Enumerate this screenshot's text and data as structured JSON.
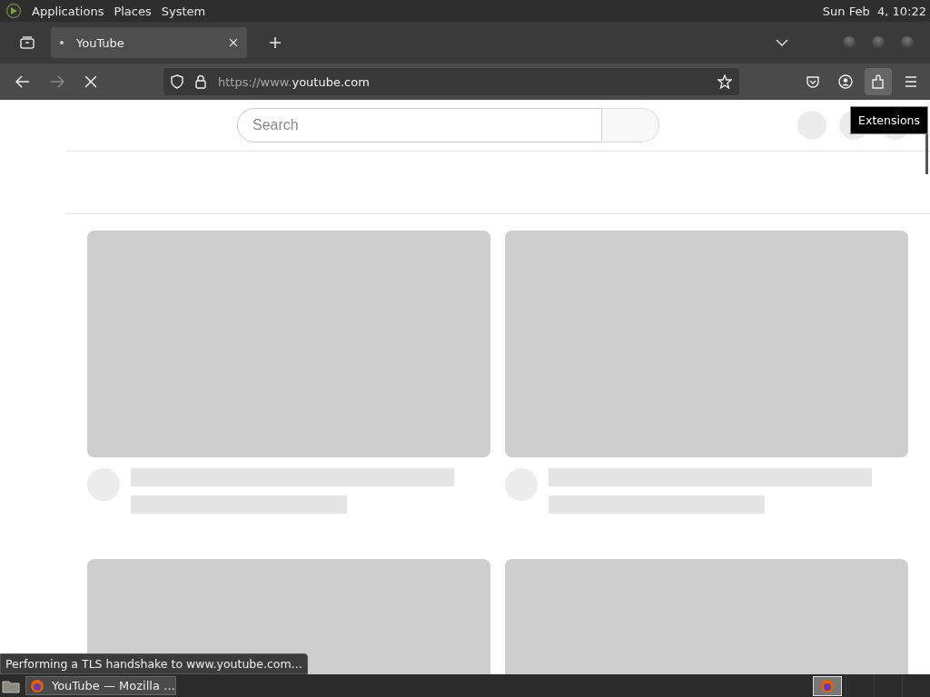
{
  "top_panel": {
    "menus": [
      {
        "label": "Applications"
      },
      {
        "label": "Places"
      },
      {
        "label": "System"
      }
    ],
    "clock": "Sun Feb  4, 10:22"
  },
  "tabs": [
    {
      "title": "YouTube",
      "selected": true
    }
  ],
  "navigation": {
    "loading": true,
    "forward_disabled": true
  },
  "address_bar": {
    "url_prefix": "https://www.",
    "url_host": "youtube.com"
  },
  "toolbar_buttons": [
    {
      "kind": "pocket",
      "hovered": false
    },
    {
      "kind": "account",
      "hovered": false
    },
    {
      "kind": "extensions",
      "hovered": true
    },
    {
      "kind": "menu",
      "hovered": false
    }
  ],
  "tooltip": "Extensions",
  "page": {
    "search": {
      "placeholder": "Search"
    }
  },
  "status": "Performing a TLS handshake to www.youtube.com…",
  "taskbar": {
    "tasks": [
      {
        "label": "YouTube — Mozilla …",
        "selected": true
      }
    ]
  }
}
